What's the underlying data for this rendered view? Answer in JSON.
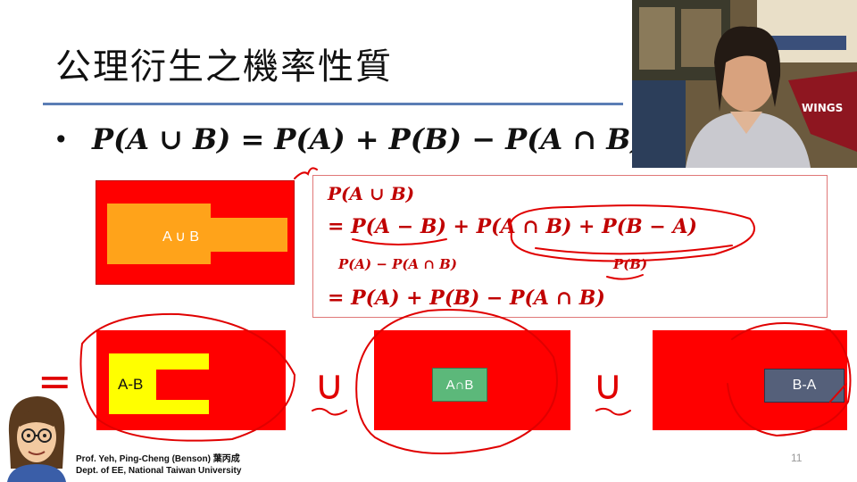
{
  "slide": {
    "title": "公理衍生之機率性質",
    "bullet": "•",
    "formula": "P(A ∪ B) = P(A) + P(B) − P(A ∩ B)",
    "page_number": "11"
  },
  "union_label": "A ∪ B",
  "derivation": {
    "line1": "P(A ∪ B)",
    "line2": "= P(A − B)   +   P(A ∩ B) + P(B − A)",
    "annotation_left": "P(A) − P(A ∩ B)",
    "annotation_right": "P(B)",
    "line3": "= P(A) + P(B) − P(A ∩ B)"
  },
  "decomposition": {
    "equals": "=",
    "union_symbol": "∪",
    "panel1_label": "A-B",
    "panel2_label": "A∩B",
    "panel3_label": "B-A"
  },
  "credit": {
    "line1": "Prof. Yeh, Ping-Cheng (Benson) 葉丙成",
    "line2": "Dept. of EE,  National Taiwan University"
  },
  "colors": {
    "region_red": "#ff0000",
    "orange": "#ffa31a",
    "yellow": "#ffff00",
    "green_box": "#5cb87a",
    "slate_box": "#55607a",
    "ink_red": "#e00000",
    "rule_blue": "#5b7db5"
  }
}
